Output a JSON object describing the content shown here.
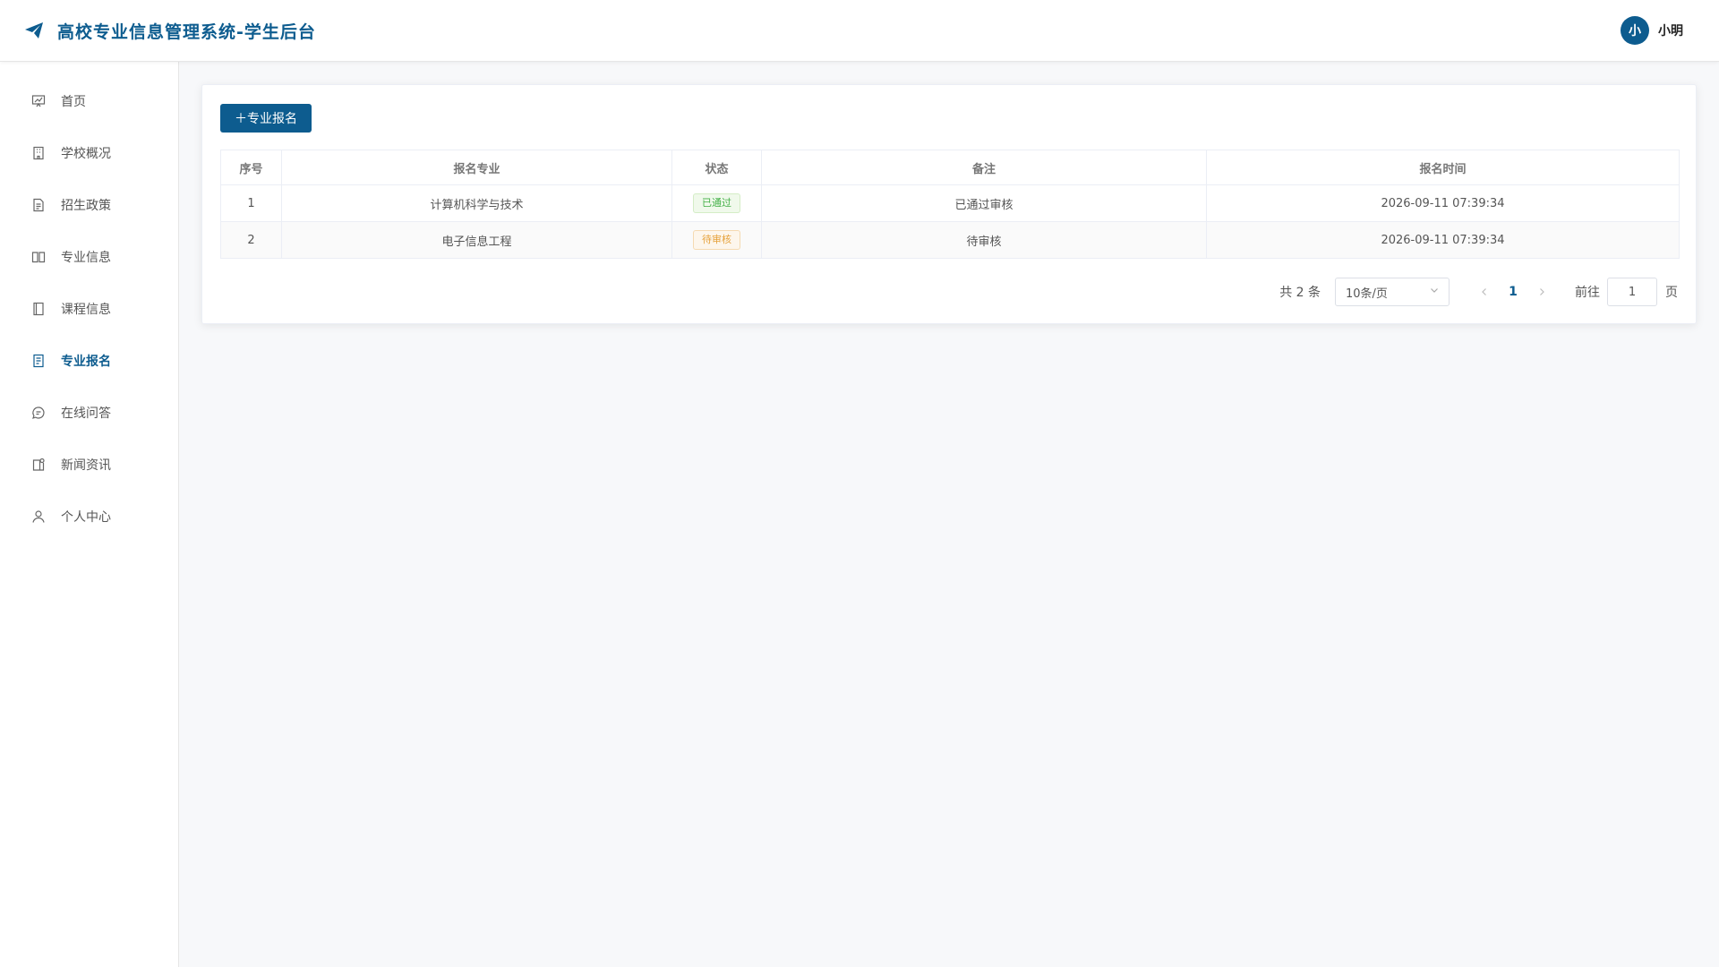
{
  "header": {
    "title": "高校专业信息管理系统-学生后台",
    "brand_icon": "paper-plane-icon",
    "user": {
      "avatar_text": "小",
      "name": "小明"
    }
  },
  "sidebar": {
    "items": [
      {
        "label": "首页",
        "icon": "dashboard-icon",
        "active": false
      },
      {
        "label": "学校概况",
        "icon": "building-icon",
        "active": false
      },
      {
        "label": "招生政策",
        "icon": "document-icon",
        "active": false
      },
      {
        "label": "专业信息",
        "icon": "book-icon",
        "active": false
      },
      {
        "label": "课程信息",
        "icon": "notebook-icon",
        "active": false
      },
      {
        "label": "专业报名",
        "icon": "form-icon",
        "active": true
      },
      {
        "label": "在线问答",
        "icon": "chat-icon",
        "active": false
      },
      {
        "label": "新闻资讯",
        "icon": "news-icon",
        "active": false
      },
      {
        "label": "个人中心",
        "icon": "user-icon",
        "active": false
      }
    ]
  },
  "toolbar": {
    "add_label": "＋专业报名"
  },
  "table": {
    "columns": [
      "序号",
      "报名专业",
      "状态",
      "备注",
      "报名时间"
    ],
    "rows": [
      {
        "index": "1",
        "major": "计算机科学与技术",
        "status": "已通过",
        "status_type": "success",
        "remark": "已通过审核",
        "time": "2026-09-11 07:39:34"
      },
      {
        "index": "2",
        "major": "电子信息工程",
        "status": "待审核",
        "status_type": "warning",
        "remark": "待审核",
        "time": "2026-09-11 07:39:34"
      }
    ]
  },
  "pagination": {
    "total_text": "共 2 条",
    "page_size": "10条/页",
    "current_page": "1",
    "goto_label": "前往",
    "goto_value": "1",
    "goto_suffix": "页"
  },
  "colors": {
    "brand": "#0d5c8f",
    "success": "#43b047",
    "warning": "#e6a23c"
  }
}
